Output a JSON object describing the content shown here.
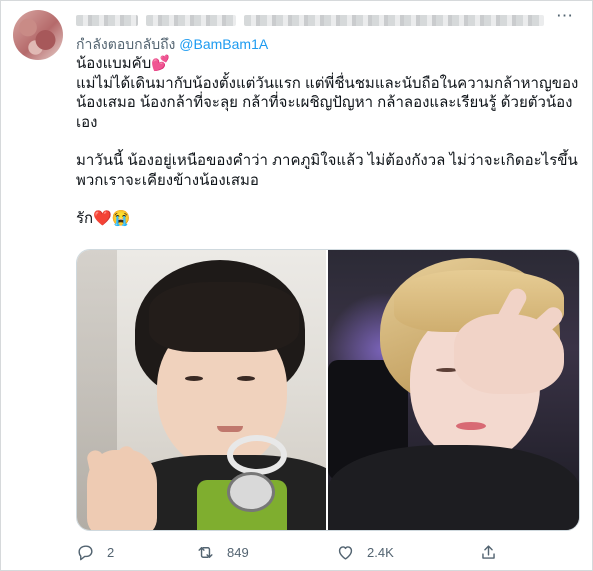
{
  "tweet": {
    "reply_prefix": "กำลังตอบกลับถึง",
    "reply_handle": "@BamBam1A",
    "paragraphs": [
      "น้องแบมคับ💕\nแม่ไม่ได้เดินมากับน้องตั้งแต่วันแรก แต่พี่ชื่นชมและนับถือในความกล้าหาญของน้องเสมอ น้องกล้าที่จะลุย กล้าที่จะเผชิญปัญหา กล้าลองและเรียนรู้ ด้วยตัวน้องเอง",
      "มาวันนี้ น้องอยู่เหนือของคำว่า ภาคภูมิใจแล้ว ไม่ต้องกังวล ไม่ว่าจะเกิดอะไรขึ้น พวกเราจะเคียงข้างน้องเสมอ",
      "รัก❤️😭"
    ],
    "media": [
      "photo-left",
      "photo-right"
    ]
  },
  "actions": {
    "reply_count": "2",
    "retweet_count": "849",
    "like_count": "2.4K"
  },
  "icons": {
    "reply": "reply-icon",
    "retweet": "retweet-icon",
    "like": "heart-icon",
    "share": "share-icon",
    "more": "more-icon"
  },
  "colors": {
    "accent": "#1d9bf0",
    "text": "#0f1419",
    "muted": "#536471",
    "border": "#cfd9de"
  }
}
